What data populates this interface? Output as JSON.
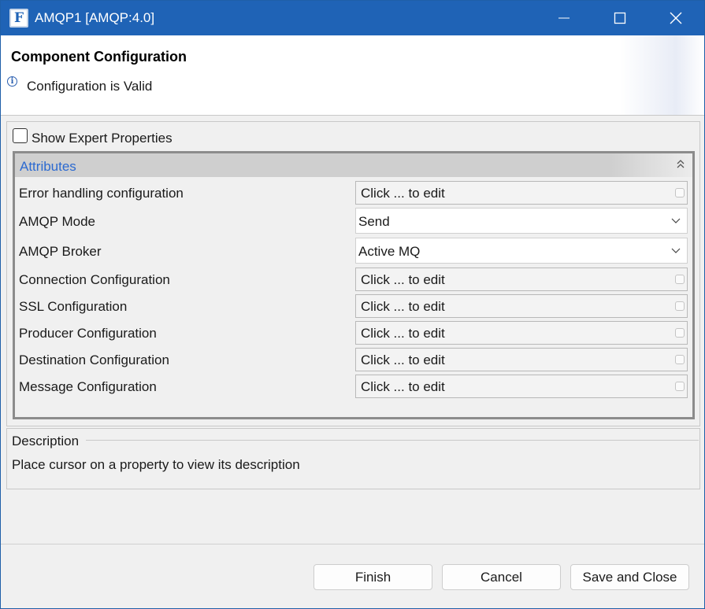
{
  "window": {
    "title": "AMQP1 [AMQP:4.0]",
    "app_icon": "F",
    "accent_color": "#1f63b6",
    "controls": [
      "minimize-icon",
      "maximize-icon",
      "close-icon"
    ]
  },
  "header": {
    "title": "Component Configuration",
    "status": "Configuration is Valid",
    "status_icon": "info-icon"
  },
  "options": {
    "show_expert_label": "Show Expert Properties",
    "show_expert_checked": false
  },
  "attributes": {
    "title": "Attributes",
    "collapse_icon": "double-chevron-up-icon",
    "rows": [
      {
        "label": "Error handling configuration",
        "value": "Click ... to edit",
        "kind": "editor"
      },
      {
        "label": "AMQP Mode",
        "value": "Send",
        "kind": "combo"
      },
      {
        "label": "AMQP Broker",
        "value": "Active MQ",
        "kind": "combo"
      },
      {
        "label": "Connection Configuration",
        "value": "Click ... to edit",
        "kind": "editor"
      },
      {
        "label": "SSL Configuration",
        "value": "Click ... to edit",
        "kind": "editor"
      },
      {
        "label": "Producer Configuration",
        "value": "Click ... to edit",
        "kind": "editor"
      },
      {
        "label": "Destination Configuration",
        "value": "Click ... to edit",
        "kind": "editor"
      },
      {
        "label": "Message Configuration",
        "value": "Click ... to edit",
        "kind": "editor"
      }
    ]
  },
  "description": {
    "title": "Description",
    "text": "Place cursor on a property to view its description"
  },
  "buttons": {
    "finish": "Finish",
    "cancel": "Cancel",
    "save_close": "Save and Close"
  }
}
